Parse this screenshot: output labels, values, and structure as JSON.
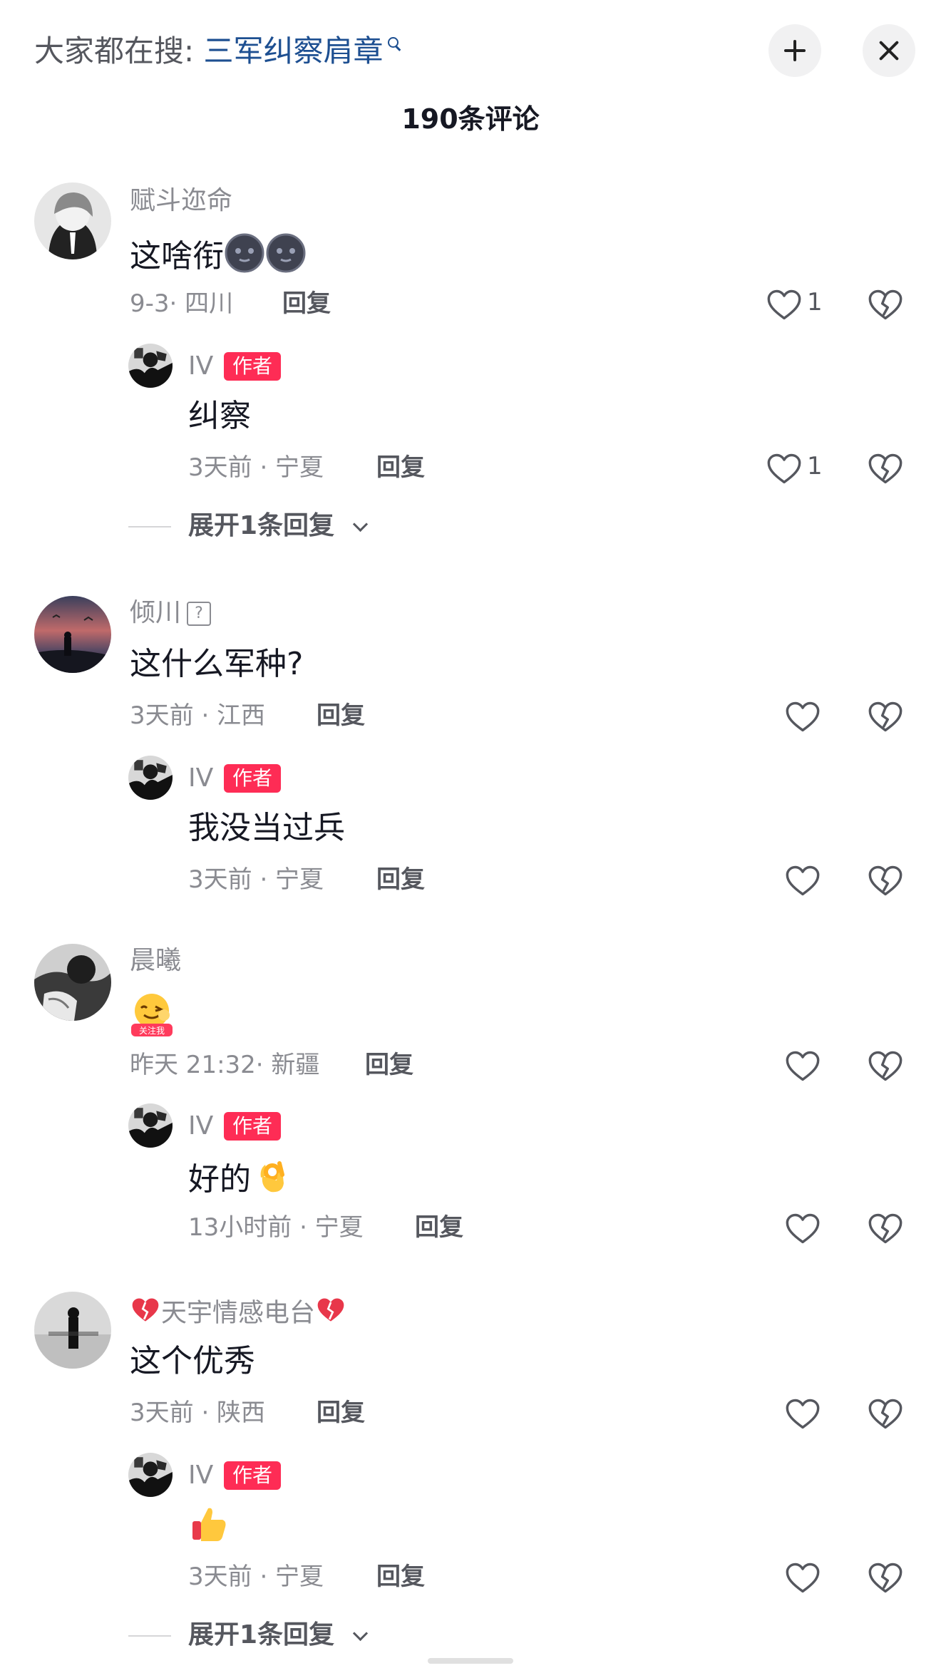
{
  "header": {
    "search_prefix": "大家都在搜: ",
    "search_term": "三军纠察肩章",
    "comment_count": "190条评论"
  },
  "colors": {
    "accent_red": "#fe2c55",
    "link_blue": "#1d4f91",
    "meta_gray": "#8a8b91"
  },
  "comments": [
    {
      "username": "赋斗迩命",
      "text": "这啥衔",
      "emoji": "dark-moon-face-emoji ×2",
      "meta": "9-3· 四川",
      "reply": "回复",
      "likes": "1",
      "replies": [
        {
          "username": "IV",
          "badge": "作者",
          "text": "纠察",
          "meta": "3天前 · 宁夏",
          "reply": "回复",
          "likes": "1"
        }
      ],
      "expand": "展开1条回复"
    },
    {
      "username": "倾川",
      "text": "这什么军种?",
      "meta": "3天前 · 江西",
      "reply": "回复",
      "replies": [
        {
          "username": "IV",
          "badge": "作者",
          "text": "我没当过兵",
          "meta": "3天前 · 宁夏",
          "reply": "回复"
        }
      ]
    },
    {
      "username": "晨曦",
      "sticker_text": "关注我",
      "meta": "昨天 21:32· 新疆",
      "reply": "回复",
      "replies": [
        {
          "username": "IV",
          "badge": "作者",
          "text": "好的",
          "emoji": "ok-hand-emoji",
          "meta": "13小时前 · 宁夏",
          "reply": "回复"
        }
      ]
    },
    {
      "username": "天宇情感电台",
      "username_emoji": "broken-heart-emoji",
      "text": "这个优秀",
      "meta": "3天前 · 陕西",
      "reply": "回复",
      "replies": [
        {
          "username": "IV",
          "badge": "作者",
          "emoji": "thumbs-up-emoji",
          "meta": "3天前 · 宁夏",
          "reply": "回复"
        }
      ],
      "expand": "展开1条回复"
    }
  ]
}
